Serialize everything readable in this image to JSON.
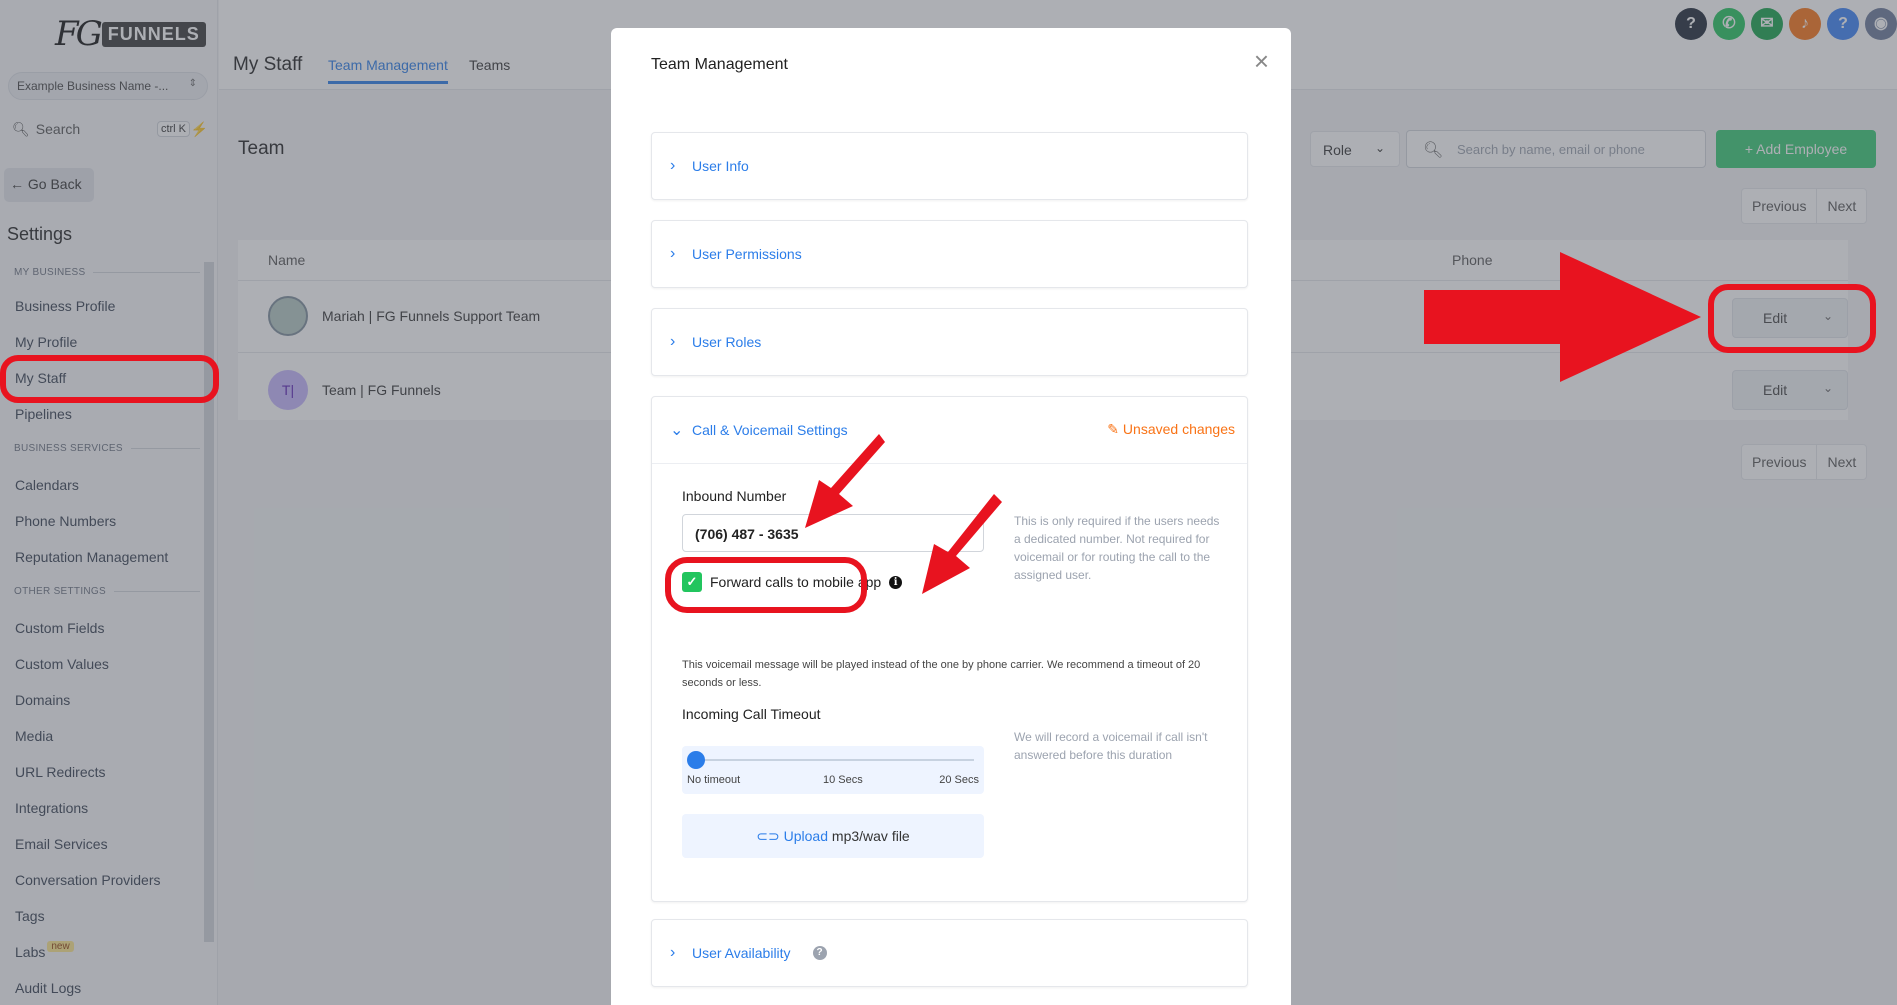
{
  "sidebar": {
    "logo_fg": "FG",
    "logo_funnels": "FUNNELS",
    "location": "Example Business Name -...",
    "search_label": "Search",
    "search_shortcut": "ctrl K",
    "go_back": "Go Back",
    "settings_title": "Settings",
    "sections": {
      "my_business": "MY BUSINESS",
      "business_services": "BUSINESS SERVICES",
      "other_settings": "OTHER SETTINGS"
    },
    "items": {
      "business_profile": "Business Profile",
      "my_profile": "My Profile",
      "my_staff": "My Staff",
      "pipelines": "Pipelines",
      "calendars": "Calendars",
      "phone_numbers": "Phone Numbers",
      "reputation_management": "Reputation Management",
      "custom_fields": "Custom Fields",
      "custom_values": "Custom Values",
      "domains": "Domains",
      "media": "Media",
      "url_redirects": "URL Redirects",
      "integrations": "Integrations",
      "email_services": "Email Services",
      "conversation_providers": "Conversation Providers",
      "tags": "Tags",
      "labs": "Labs",
      "labs_badge": "new",
      "audit_logs": "Audit Logs"
    }
  },
  "header": {
    "page_title": "My Staff",
    "tabs": [
      "Team Management",
      "Teams"
    ]
  },
  "team": {
    "title": "Team",
    "role_select": "Role",
    "search_placeholder": "Search by name, email or phone",
    "add_button": "Add Employee",
    "pager_previous": "Previous",
    "pager_next": "Next",
    "columns": {
      "name": "Name",
      "phone": "Phone"
    },
    "members": [
      {
        "name": "Mariah | FG Funnels Support Team",
        "action": "Edit"
      },
      {
        "name": "Team | FG Funnels",
        "initials": "T|",
        "action": "Edit"
      }
    ]
  },
  "modal": {
    "title": "Team Management",
    "sections": {
      "user_info": "User Info",
      "user_permissions": "User Permissions",
      "user_roles": "User Roles",
      "call_voicemail": "Call & Voicemail Settings",
      "user_availability": "User Availability"
    },
    "unsaved": "Unsaved changes",
    "inbound_label": "Inbound Number",
    "inbound_value": "(706) 487 - 3635",
    "inbound_help": "This is only required if the users needs a dedicated number. Not required for voicemail or for routing the call to the assigned user.",
    "forward_label": "Forward calls to mobile app",
    "voicemail_message": "This voicemail message will be played instead of the one by phone carrier. We recommend a timeout of 20 seconds or less.",
    "timeout_label": "Incoming Call Timeout",
    "timeout_help": "We will record a voicemail if call isn't answered before this duration",
    "slider_labels": [
      "No timeout",
      "10 Secs",
      "20 Secs"
    ],
    "upload_link": "Upload",
    "upload_rest": " mp3/wav file"
  },
  "colors": {
    "accent": "#2b7de9",
    "green": "#37ca74",
    "annotation_red": "#e8131f",
    "unsaved_orange": "#f97316"
  }
}
